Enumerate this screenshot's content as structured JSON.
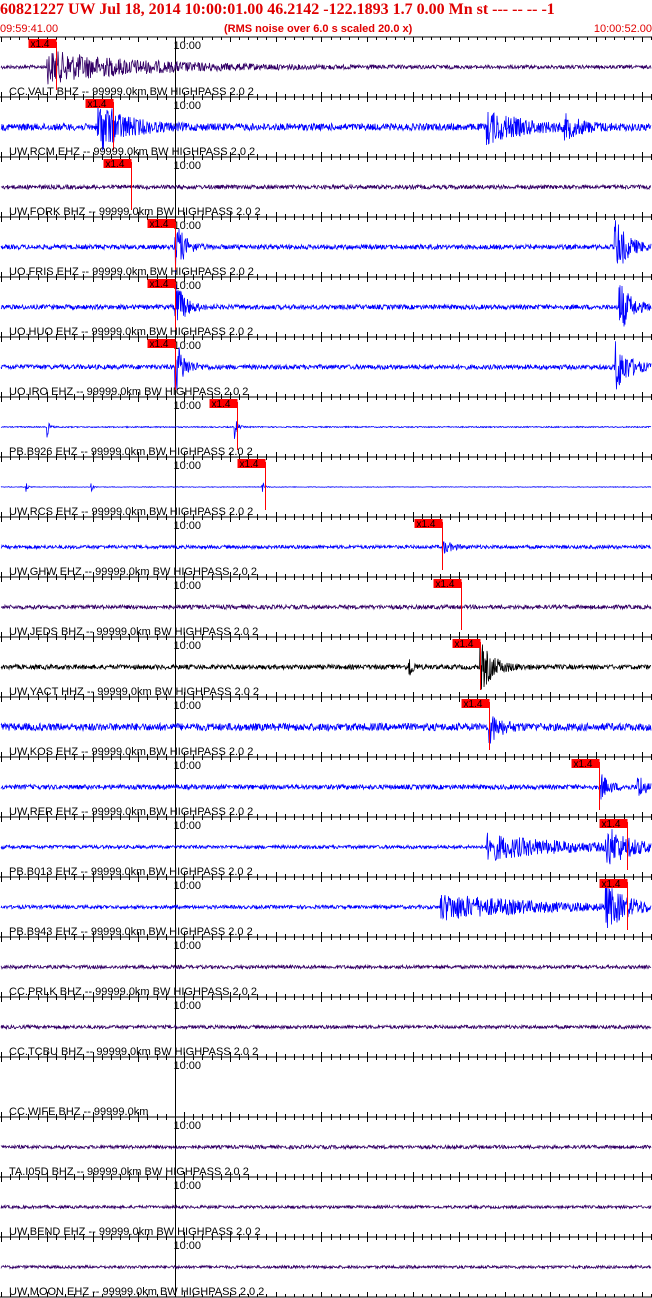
{
  "header": {
    "title": "60821227 UW Jul 18, 2014 10:00:01.00   46.2142 -122.1893  1.7 0.00 Mn st --- -- --  -1",
    "start_time": "09:59:41.00",
    "noise_note": "(RMS noise over 6.0 s scaled 20.0 x)",
    "end_time": "10:00:52.00"
  },
  "chart_data": {
    "type": "line",
    "title": "60821227 UW Jul 18, 2014 10:00:01.00   46.2142 -122.1893  1.7 0.00 Mn st --- -- --  -1",
    "xlabel": "",
    "ylabel": "",
    "time_range": [
      "09:59:41.00",
      "10:00:52.00"
    ],
    "x_range_seconds": [
      0,
      71
    ],
    "minute_marker": {
      "label": "10:00",
      "time_s": 19
    },
    "pick_label": "x1.4",
    "grid": true,
    "colors": {
      "blue": "#0000ff",
      "purple": "#330066",
      "black": "#000000",
      "pick": "#ff0000",
      "text": "#e00000"
    },
    "channels": [
      {
        "label": "CC.VALT BHZ -- 99999.0km BW  HIGHPASS  2.0  2",
        "color": "#330066",
        "pick_s": 6.0,
        "noise": 0.06,
        "bursts": [
          {
            "t": 5,
            "amp": 0.55,
            "dur": 22
          }
        ]
      },
      {
        "label": "UW.RCM EHZ -- 99999.0km BW  HIGHPASS  2.0  2",
        "color": "#0000ff",
        "pick_s": 12.2,
        "noise": 0.12,
        "bursts": [
          {
            "t": 10.5,
            "amp": 0.95,
            "dur": 6
          },
          {
            "t": 53,
            "amp": 0.55,
            "dur": 8
          },
          {
            "t": 61.5,
            "amp": 0.35,
            "dur": 4
          }
        ]
      },
      {
        "label": "UW.FORK BHZ -- 99999.0km BW  HIGHPASS  2.0  2",
        "color": "#330066",
        "pick_s": 14.2,
        "noise": 0.07,
        "bursts": []
      },
      {
        "label": "UO.FRIS EHZ -- 99999.0km BW  HIGHPASS  2.0  2",
        "color": "#0000ff",
        "pick_s": 19.0,
        "noise": 0.08,
        "bursts": [
          {
            "t": 19,
            "amp": 1.0,
            "dur": 2
          },
          {
            "t": 67,
            "amp": 1.0,
            "dur": 3
          }
        ]
      },
      {
        "label": "UO.HUO EHZ -- 99999.0km BW  HIGHPASS  2.0  2",
        "color": "#0000ff",
        "pick_s": 19.0,
        "noise": 0.08,
        "bursts": [
          {
            "t": 19,
            "amp": 1.0,
            "dur": 2
          },
          {
            "t": 67.5,
            "amp": 1.0,
            "dur": 2.5
          }
        ]
      },
      {
        "label": "UO.IRO EHZ -- 99999.0km BW  HIGHPASS  2.0  2",
        "color": "#0000ff",
        "pick_s": 19.0,
        "noise": 0.08,
        "bursts": [
          {
            "t": 19,
            "amp": 1.0,
            "dur": 2
          },
          {
            "t": 67,
            "amp": 1.0,
            "dur": 3
          }
        ]
      },
      {
        "label": "PB.B926 EHZ -- 99999.0km BW  HIGHPASS  2.0  2",
        "color": "#0000ff",
        "pick_s": 25.8,
        "noise": 0.02,
        "bursts": [
          {
            "t": 5,
            "amp": 0.4,
            "dur": 0.5
          },
          {
            "t": 25.5,
            "amp": 0.45,
            "dur": 0.6
          }
        ]
      },
      {
        "label": "UW.RCS EHZ -- 99999.0km BW  HIGHPASS  2.0  2",
        "color": "#0000ff",
        "pick_s": 28.8,
        "noise": 0.01,
        "bursts": [
          {
            "t": 2.7,
            "amp": 0.2,
            "dur": 0.4
          },
          {
            "t": 9.8,
            "amp": 0.25,
            "dur": 0.4
          },
          {
            "t": 28.5,
            "amp": 0.25,
            "dur": 0.5
          }
        ]
      },
      {
        "label": "UW.GHW EHZ -- 99999.0km BW  HIGHPASS  2.0  2",
        "color": "#0000ff",
        "pick_s": 48.2,
        "noise": 0.06,
        "bursts": [
          {
            "t": 48.2,
            "amp": 0.25,
            "dur": 2
          }
        ]
      },
      {
        "label": "UW.JEDS BHZ -- 99999.0km BW  HIGHPASS  2.0  2",
        "color": "#330066",
        "pick_s": 50.2,
        "noise": 0.07,
        "bursts": []
      },
      {
        "label": "UW.YACT HHZ -- 99999.0km BW  HIGHPASS  2.0  2",
        "color": "#000000",
        "pick_s": 52.3,
        "noise": 0.08,
        "bursts": [
          {
            "t": 44.5,
            "amp": 0.55,
            "dur": 0.8
          },
          {
            "t": 52.3,
            "amp": 0.9,
            "dur": 3
          }
        ]
      },
      {
        "label": "UW.KOS EHZ -- 99999.0km BW  HIGHPASS  2.0  2",
        "color": "#0000ff",
        "pick_s": 53.3,
        "noise": 0.13,
        "bursts": [
          {
            "t": 53.3,
            "amp": 0.55,
            "dur": 2.5
          }
        ]
      },
      {
        "label": "UW.RER EHZ -- 99999.0km BW  HIGHPASS  2.0  2",
        "color": "#0000ff",
        "pick_s": 65.3,
        "noise": 0.08,
        "bursts": [
          {
            "t": 65.5,
            "amp": 0.45,
            "dur": 2
          },
          {
            "t": 69.5,
            "amp": 0.55,
            "dur": 1.5
          }
        ]
      },
      {
        "label": "PB.B013 EHZ -- 99999.0km BW  HIGHPASS  2.0  2",
        "color": "#0000ff",
        "pick_s": 68.4,
        "noise": 0.06,
        "bursts": [
          {
            "t": 53,
            "amp": 0.45,
            "dur": 18
          },
          {
            "t": 66,
            "amp": 0.7,
            "dur": 5
          }
        ]
      },
      {
        "label": "PB.B943 EHZ -- 99999.0km BW  HIGHPASS  2.0  2",
        "color": "#0000ff",
        "pick_s": 68.4,
        "noise": 0.06,
        "bursts": [
          {
            "t": 48,
            "amp": 0.45,
            "dur": 22
          },
          {
            "t": 66,
            "amp": 0.75,
            "dur": 5
          }
        ]
      },
      {
        "label": "CC.PRLK BHZ -- 99999.0km BW  HIGHPASS  2.0  2",
        "color": "#330066",
        "pick_s": null,
        "noise": 0.06,
        "bursts": []
      },
      {
        "label": "CC.TCBU BHZ -- 99999.0km BW  HIGHPASS  2.0  2",
        "color": "#330066",
        "pick_s": null,
        "noise": 0.06,
        "bursts": []
      },
      {
        "label": "CC.WIFE BHZ -- 99999.0km",
        "color": "#330066",
        "pick_s": null,
        "noise": 0,
        "bursts": []
      },
      {
        "label": "TA.I05D BHZ -- 99999.0km BW  HIGHPASS  2.0  2",
        "color": "#330066",
        "pick_s": null,
        "noise": 0.06,
        "bursts": []
      },
      {
        "label": "UW.BEND EHZ -- 99999.0km BW  HIGHPASS  2.0  2",
        "color": "#330066",
        "pick_s": null,
        "noise": 0.05,
        "bursts": []
      },
      {
        "label": "UW.MOON EHZ -- 99999.0km BW  HIGHPASS  2.0  2",
        "color": "#330066",
        "pick_s": null,
        "noise": 0.05,
        "bursts": []
      }
    ]
  }
}
